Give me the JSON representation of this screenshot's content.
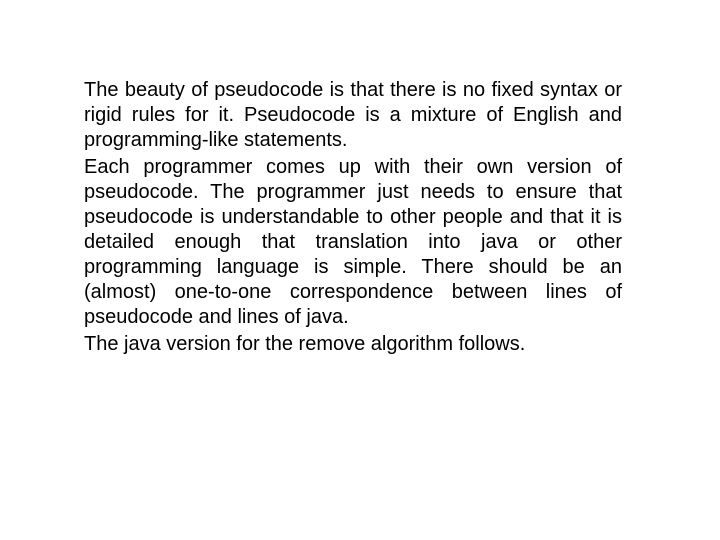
{
  "paragraphs": {
    "p1": "The beauty of pseudocode is that there is no fixed syntax or rigid rules for it. Pseudocode is a mixture of English and programming-like statements.",
    "p2": "Each programmer comes up with their own version of pseudocode. The programmer just needs to ensure that pseudocode is understandable to other people and that it is detailed enough that translation into java or other programming language is simple. There should be an (almost) one-to-one correspondence between lines of pseudocode and lines of java.",
    "p3": "The java version for the remove algorithm follows."
  }
}
